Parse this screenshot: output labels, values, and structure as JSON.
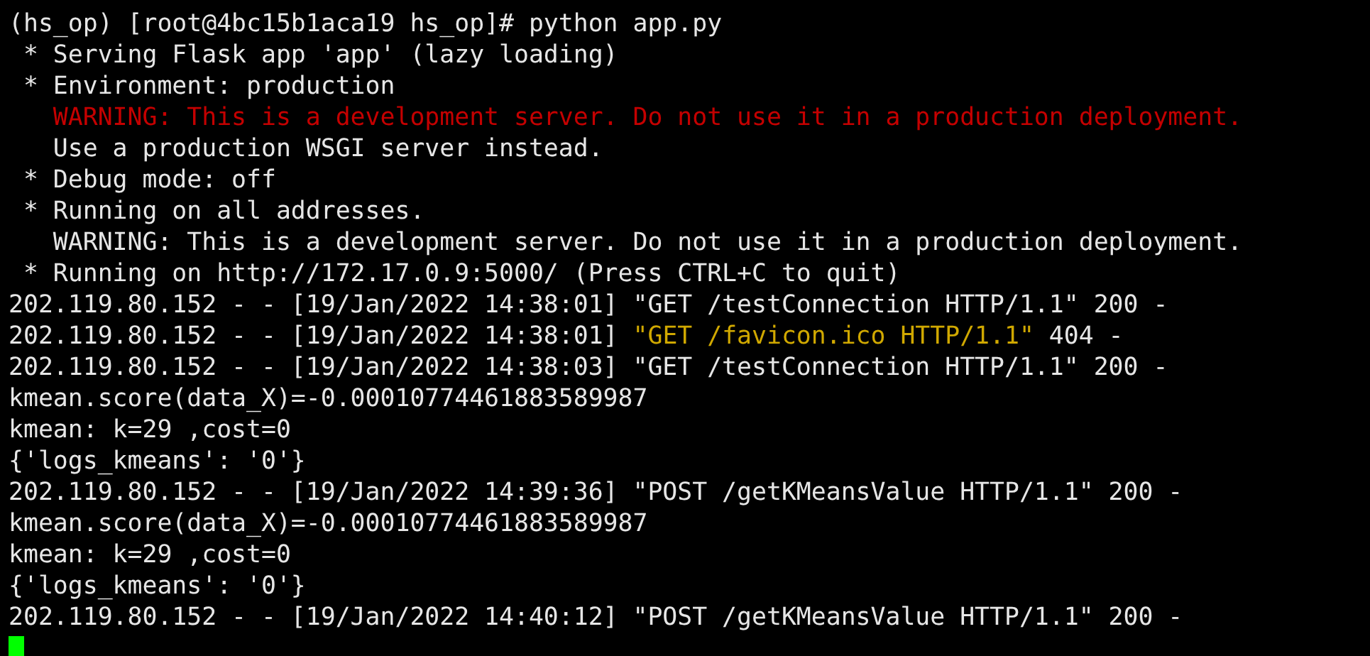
{
  "terminal": {
    "lines": [
      {
        "segments": [
          {
            "kind": "plain",
            "text": "(hs_op) [root@4bc15b1aca19 hs_op]# python app.py"
          }
        ]
      },
      {
        "segments": [
          {
            "kind": "plain",
            "text": " * Serving Flask app 'app' (lazy loading)"
          }
        ]
      },
      {
        "segments": [
          {
            "kind": "plain",
            "text": " * Environment: production"
          }
        ]
      },
      {
        "segments": [
          {
            "kind": "error",
            "text": "   WARNING: This is a development server. Do not use it in a production deployment."
          }
        ]
      },
      {
        "segments": [
          {
            "kind": "plain",
            "text": "   Use a production WSGI server instead."
          }
        ]
      },
      {
        "segments": [
          {
            "kind": "plain",
            "text": " * Debug mode: off"
          }
        ]
      },
      {
        "segments": [
          {
            "kind": "plain",
            "text": " * Running on all addresses."
          }
        ]
      },
      {
        "segments": [
          {
            "kind": "plain",
            "text": "   WARNING: This is a development server. Do not use it in a production deployment."
          }
        ]
      },
      {
        "segments": [
          {
            "kind": "plain",
            "text": " * Running on http://172.17.0.9:5000/ (Press CTRL+C to quit)"
          }
        ]
      },
      {
        "segments": [
          {
            "kind": "plain",
            "text": "202.119.80.152 - - [19/Jan/2022 14:38:01] \"GET /testConnection HTTP/1.1\" 200 -"
          }
        ]
      },
      {
        "segments": [
          {
            "kind": "plain",
            "text": "202.119.80.152 - - [19/Jan/2022 14:38:01] "
          },
          {
            "kind": "highlight",
            "text": "\"GET /favicon.ico HTTP/1.1\""
          },
          {
            "kind": "plain",
            "text": " 404 -"
          }
        ]
      },
      {
        "segments": [
          {
            "kind": "plain",
            "text": "202.119.80.152 - - [19/Jan/2022 14:38:03] \"GET /testConnection HTTP/1.1\" 200 -"
          }
        ]
      },
      {
        "segments": [
          {
            "kind": "plain",
            "text": "kmean.score(data_X)=-0.00010774461883589987"
          }
        ]
      },
      {
        "segments": [
          {
            "kind": "plain",
            "text": "kmean: k=29 ,cost=0"
          }
        ]
      },
      {
        "segments": [
          {
            "kind": "plain",
            "text": "{'logs_kmeans': '0'}"
          }
        ]
      },
      {
        "segments": [
          {
            "kind": "plain",
            "text": "202.119.80.152 - - [19/Jan/2022 14:39:36] \"POST /getKMeansValue HTTP/1.1\" 200 -"
          }
        ]
      },
      {
        "segments": [
          {
            "kind": "plain",
            "text": "kmean.score(data_X)=-0.00010774461883589987"
          }
        ]
      },
      {
        "segments": [
          {
            "kind": "plain",
            "text": "kmean: k=29 ,cost=0"
          }
        ]
      },
      {
        "segments": [
          {
            "kind": "plain",
            "text": "{'logs_kmeans': '0'}"
          }
        ]
      },
      {
        "segments": [
          {
            "kind": "plain",
            "text": "202.119.80.152 - - [19/Jan/2022 14:40:12] \"POST /getKMeansValue HTTP/1.1\" 200 -"
          }
        ]
      }
    ]
  }
}
